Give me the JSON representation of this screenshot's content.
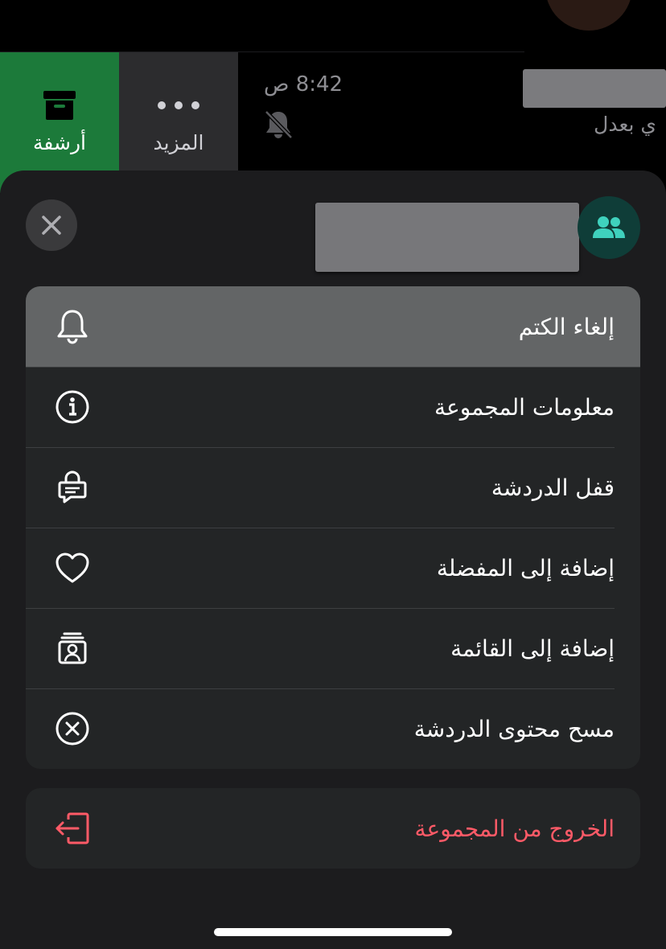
{
  "background": {
    "swipe_actions": {
      "archive_label": "أرشفة",
      "more_label": "المزيد"
    },
    "chat_row": {
      "time": "8:42 ص",
      "preview": "ي بعدل",
      "mute_icon": "bell-slash-icon"
    }
  },
  "sheet": {
    "close_icon": "xmark-icon",
    "avatar_icon": "group-people-icon",
    "menu": [
      {
        "label": "إلغاء الكتم",
        "icon": "bell-icon"
      },
      {
        "label": "معلومات المجموعة",
        "icon": "info-circle-icon"
      },
      {
        "label": "قفل الدردشة",
        "icon": "chat-lock-icon"
      },
      {
        "label": "إضافة إلى المفضلة",
        "icon": "heart-icon"
      },
      {
        "label": "إضافة إلى القائمة",
        "icon": "contact-list-icon"
      },
      {
        "label": "مسح محتوى الدردشة",
        "icon": "xmark-circle-icon"
      }
    ],
    "exit": {
      "label": "الخروج من المجموعة",
      "icon": "exit-door-icon"
    }
  },
  "colors": {
    "archive_green": "#1c7a3a",
    "destructive_red": "#ff5a67",
    "avatar_teal": "#3fd1bd"
  }
}
